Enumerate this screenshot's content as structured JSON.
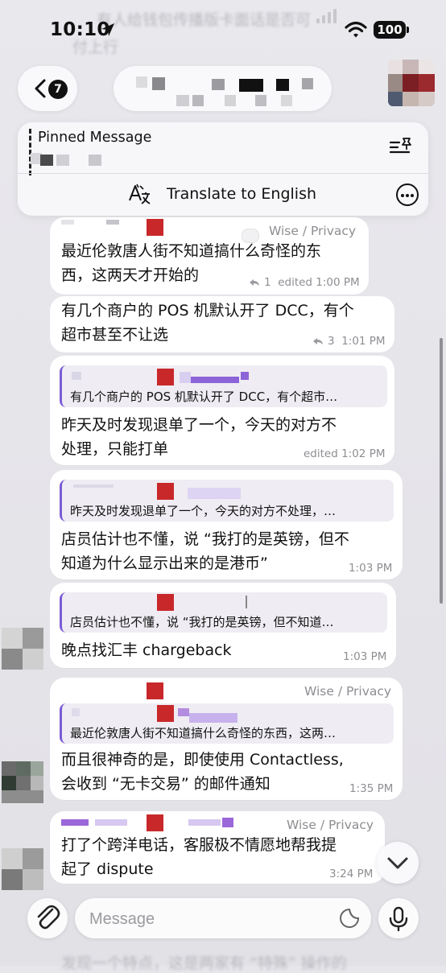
{
  "status_bar": {
    "time": "10:10",
    "battery": "100"
  },
  "header": {
    "back_badge": "7"
  },
  "pinned": {
    "title": "Pinned Message",
    "translate_label": "Translate to English"
  },
  "messages": [
    {
      "tag": "Wise / Privacy",
      "lines": [
        "最近伦敦唐人街不知道搞什么奇怪的东",
        "西，这两天才开始的"
      ],
      "replies": "1",
      "meta": "edited 1:00 PM"
    },
    {
      "lines": [
        "有几个商户的 POS 机默认开了 DCC，有个",
        "超市甚至不让选"
      ],
      "replies": "3",
      "meta": "1:01 PM"
    },
    {
      "quote": "有几个商户的 POS 机默认开了 DCC，有个超市…",
      "lines": [
        "昨天及时发现退单了一个，今天的对方不",
        "处理，只能打单"
      ],
      "meta": "edited 1:02 PM"
    },
    {
      "quote": "昨天及时发现退单了一个，今天的对方不处理，…",
      "lines": [
        "店员估计也不懂，说 “我打的是英镑，但不",
        "知道为什么显示出来的是港币”"
      ],
      "meta": "1:03 PM"
    },
    {
      "quote": "店员估计也不懂，说 “我打的是英镑，但不知道…",
      "lines": [
        "晚点找汇丰 chargeback"
      ],
      "meta": "1:03 PM"
    },
    {
      "tag": "Wise / Privacy",
      "quote": "最近伦敦唐人街不知道搞什么奇怪的东西，这两…",
      "lines": [
        "而且很神奇的是，即使使用 Contactless,",
        "会收到 “无卡交易” 的邮件通知"
      ],
      "meta": "1:35 PM"
    },
    {
      "tag": "Wise / Privacy",
      "lines": [
        "打了个跨洋电话，客服极不情愿地帮我提",
        "起了 dispute"
      ],
      "meta": "3:24 PM"
    }
  ],
  "background_text": {
    "top": "有人给钱包传播版卡面话是否可",
    "top2": "付上行",
    "bottom": "发现一个特点，这是两家有 “特殊” 操作的"
  },
  "input": {
    "placeholder": "Message"
  }
}
